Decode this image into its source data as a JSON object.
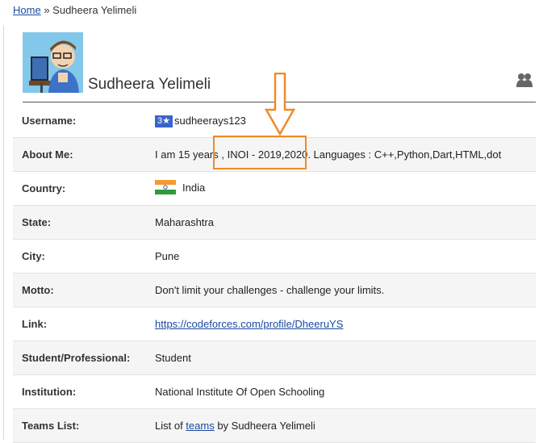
{
  "breadcrumb": {
    "home": "Home",
    "separator": "»",
    "current": "Sudheera Yelimeli"
  },
  "profile": {
    "name": "Sudheera Yelimeli",
    "avatar_icon": "avatar-cartoon-icon",
    "side_icon": "people-icon"
  },
  "rows": {
    "username": {
      "label": "Username:",
      "rating": "3★",
      "value": "sudheerays123"
    },
    "about": {
      "label": "About Me:",
      "value": "I am 15 years , INOI - 2019,2020. Languages : C++,Python,Dart,HTML,dot"
    },
    "country": {
      "label": "Country:",
      "value": "India",
      "flag_icon": "india-flag-icon"
    },
    "state": {
      "label": "State:",
      "value": "Maharashtra"
    },
    "city": {
      "label": "City:",
      "value": "Pune"
    },
    "motto": {
      "label": "Motto:",
      "value": "Don't limit your challenges - challenge your limits."
    },
    "link": {
      "label": "Link:",
      "value": "https://codeforces.com/profile/DheeruYS"
    },
    "student": {
      "label": "Student/Professional:",
      "value": "Student"
    },
    "institution": {
      "label": "Institution:",
      "value": "National Institute Of Open Schooling"
    },
    "teams": {
      "label": "Teams List:",
      "prefix": "List of ",
      "link": "teams",
      "suffix": " by Sudheera Yelimeli"
    }
  },
  "colors": {
    "annotation": "#f08a2a",
    "link": "#1a4aa0",
    "rating_badge": "#3a64cc"
  }
}
